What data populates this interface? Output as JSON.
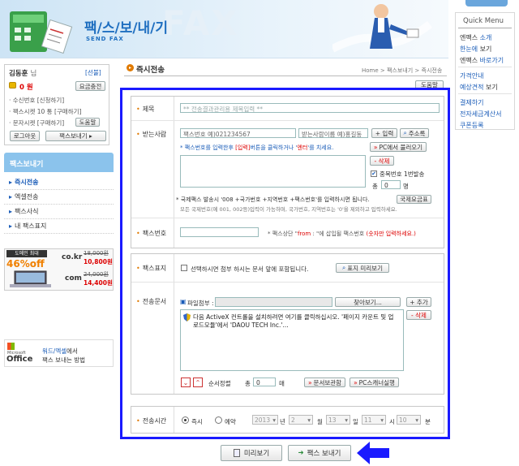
{
  "header": {
    "title": "팩/스/보/내/기",
    "subtitle": "SEND FAX",
    "bg_letters": "FAX"
  },
  "quick_menu": {
    "title": "Quick Menu",
    "items": [
      {
        "pre": "엔팩스 ",
        "hl": "소개",
        "post": ""
      },
      {
        "pre": "",
        "hl": "한눈에",
        "post": " 보기"
      },
      {
        "pre": "엔팩스 ",
        "hl": "바로가기",
        "post": ""
      },
      {
        "pre": "",
        "hl": "가격안내",
        "post": ""
      },
      {
        "pre": "",
        "hl": "예상견적",
        "post": " 보기"
      },
      {
        "pre": "",
        "hl": "결제하기",
        "post": ""
      },
      {
        "pre": "",
        "hl": "전자세금계산서",
        "post": ""
      },
      {
        "pre": "",
        "hl": "쿠폰등록",
        "post": ""
      }
    ]
  },
  "user": {
    "name": "김동훈",
    "suffix": "님",
    "badge": "[선불]",
    "balance": "0 원",
    "charge_btn": "요금충전",
    "recv_number": "· 수신번호 [신청하기]",
    "fax_sent": "· 팩스시켓  10 통 [구매하기]",
    "sms_sent": "· 문자시켓  [구매하기]",
    "help_btn": "도움말",
    "logout_btn": "로그아웃",
    "send_btn": "팩스보내기 ▸"
  },
  "left_menu": {
    "title": "팩스보내기",
    "items": [
      "즉시전송",
      "엑셀전송",
      "팩스사식",
      "내 팩스표지"
    ]
  },
  "ad": {
    "badge": "도메인 최대",
    "discount": "46%off",
    "kr_label": "co.kr",
    "kr_old": "18,000원",
    "kr_new": "10,800원",
    "com_label": "com",
    "com_old": "24,000원",
    "com_new": "14,400원"
  },
  "office": {
    "brand_small": "Microsoft",
    "brand": "Office",
    "line1_hl": "워드/엑셀",
    "line1_rest": "에서",
    "line2": "팩스 보내는 방법"
  },
  "page": {
    "title": "즉시전송",
    "breadcrumb": "Home > 팩스보내기 > 즉시전송",
    "help_btn": "도움말"
  },
  "form": {
    "subject_label": "제목",
    "subject_placeholder": "** 전송결과관리용 제목입력 **",
    "recipient_label": "받는사람",
    "fax_number_value": "팩스번호 예)021234567",
    "recipient_name_value": "받는사람이름 예)홍길동",
    "add_btn": "+ 입력",
    "address_btn": "주소록",
    "recipient_hint_pre": "* 팩스번호를 입력한후 ",
    "recipient_hint_hl1": "[입력]",
    "recipient_hint_mid": "버튼을 클릭하거나 '",
    "recipient_hint_hl2": "엔터",
    "recipient_hint_post": "'를 치세요.",
    "pc_load_btn": "PC에서 불러오기",
    "delete_btn": "- 삭제",
    "dup_label": "중복번호 1번발송",
    "total_label": "총",
    "total_value": "0",
    "total_unit": "명",
    "intl_hint1": "* 국제팩스 발송시 '008 +국가번호 +지역번호 +팩스번호'를 입력하시면 됩니다.",
    "intl_hint2": "모든 국제번호(예 001, 002등)입력이 가능하며, 국가번호, 지역번호는 '0'을 제외하고 입력하세요.",
    "intl_fee_btn": "국제요금표",
    "sender_label": "팩스번호",
    "sender_hint_pre": "* 팩스상단 \"",
    "sender_hint_hl": "from",
    "sender_hint_mid": " : \"에 삽입될 팩스번호 ",
    "sender_hint_red": "(숫자만 입력하세요.)",
    "cover_label": "팩스표지",
    "cover_checkbox_label": "선택하시면 첨부 하시는 문서 앞에 포함됩니다.",
    "cover_preview_btn": "표지 미리보기",
    "doc_label": "전송문서",
    "file_attach_label": "파일첨부 :",
    "browse_btn": "찾아보기...",
    "add_file_btn": "+ 추가",
    "del_file_btn": "- 삭제",
    "activex_msg": "다음 ActiveX 컨트롤을 설치하려면 여기를 클릭하십시오. '페이지 카운트 및 업로드모듈'에서 'DAOU TECH Inc.'...",
    "order_label": "순서정렬",
    "doc_total_label": "총",
    "doc_total_value": "0",
    "doc_total_unit": "매",
    "doc_storage_btn": "문서보관함",
    "pc_scanner_btn": "PC스캐너실행",
    "time_label": "전송시간",
    "radio_now": "즉시",
    "radio_reserve": "예약",
    "year": "2013",
    "year_unit": "년",
    "month": "2",
    "month_unit": "월",
    "day": "13",
    "day_unit": "일",
    "hour": "11",
    "hour_unit": "시",
    "minute": "10",
    "minute_unit": "분"
  },
  "actions": {
    "preview_btn": "미리보기",
    "send_btn": "팩스 보내기"
  },
  "colors": {
    "highlight_border": "#1a1aff",
    "accent_blue": "#1a5cb8",
    "accent_red": "#dd0000",
    "header_blue": "#bcd8f0",
    "section_bg": "#dfeefa"
  }
}
